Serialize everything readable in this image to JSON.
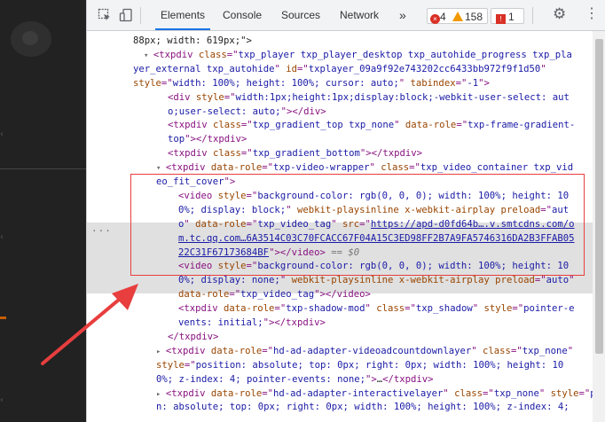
{
  "devtools": {
    "tabs": [
      "Elements",
      "Console",
      "Sources",
      "Network"
    ],
    "active_tab": "Elements",
    "more_tabs_glyph": "»",
    "status": {
      "errors": "4",
      "warnings": "158",
      "issues": "1"
    },
    "icons": {
      "inspect": "inspect-element-icon",
      "device": "device-toolbar-icon",
      "settings": "gear-icon",
      "menu": "kebab-menu-icon"
    },
    "settings_glyph": "⚙",
    "menu_glyph": "⋮"
  },
  "tree": {
    "lines": [
      {
        "parts": [
          [
            "txt",
            "88px; width: 619px;\">"
          ]
        ]
      },
      {
        "parts": [
          [
            "tri",
            "▾ "
          ],
          [
            "tag",
            "<txpdiv "
          ],
          [
            "attr",
            "class"
          ],
          [
            "tag",
            "=\""
          ],
          [
            "val",
            "txp_player txp_player_desktop txp_autohide_progress txp_pla"
          ]
        ]
      },
      {
        "parts": [
          [
            "val",
            "yer_external txp_autohide"
          ],
          [
            "tag",
            "\" "
          ],
          [
            "attr",
            "id"
          ],
          [
            "tag",
            "=\""
          ],
          [
            "val",
            "txplayer_09a9f92e743202cc6433bb972f9f1d50"
          ],
          [
            "tag",
            "\""
          ]
        ]
      },
      {
        "parts": [
          [
            "attr",
            "style"
          ],
          [
            "tag",
            "=\""
          ],
          [
            "val",
            "width: 100%; height: 100%; cursor: auto;"
          ],
          [
            "tag",
            "\" "
          ],
          [
            "attr",
            "tabindex"
          ],
          [
            "tag",
            "=\""
          ],
          [
            "val",
            "-1"
          ],
          [
            "tag",
            "\">"
          ]
        ]
      },
      {
        "parts": [
          [
            "tag",
            "<div "
          ],
          [
            "attr",
            "style"
          ],
          [
            "tag",
            "=\""
          ],
          [
            "val",
            "width:1px;height:1px;display:block;-webkit-user-select: aut"
          ]
        ]
      },
      {
        "parts": [
          [
            "val",
            "o;user-select: auto;"
          ],
          [
            "tag",
            "\"></div>"
          ]
        ]
      },
      {
        "parts": [
          [
            "tag",
            "<txpdiv "
          ],
          [
            "attr",
            "class"
          ],
          [
            "tag",
            "=\""
          ],
          [
            "val",
            "txp_gradient_top txp_none"
          ],
          [
            "tag",
            "\" "
          ],
          [
            "attr",
            "data-role"
          ],
          [
            "tag",
            "=\""
          ],
          [
            "val",
            "txp-frame-gradient-"
          ]
        ]
      },
      {
        "parts": [
          [
            "val",
            "top"
          ],
          [
            "tag",
            "\"></txpdiv>"
          ]
        ]
      },
      {
        "parts": [
          [
            "tag",
            "<txpdiv "
          ],
          [
            "attr",
            "class"
          ],
          [
            "tag",
            "=\""
          ],
          [
            "val",
            "txp_gradient_bottom"
          ],
          [
            "tag",
            "\"></txpdiv>"
          ]
        ]
      },
      {
        "parts": [
          [
            "tri",
            "▾ "
          ],
          [
            "tag",
            "<txpdiv "
          ],
          [
            "attr",
            "data-role"
          ],
          [
            "tag",
            "=\""
          ],
          [
            "val",
            "txp-video-wrapper"
          ],
          [
            "tag",
            "\" "
          ],
          [
            "attr",
            "class"
          ],
          [
            "tag",
            "=\""
          ],
          [
            "val",
            "txp_video_container txp_vid"
          ]
        ]
      },
      {
        "parts": [
          [
            "val",
            "eo_fit_cover"
          ],
          [
            "tag",
            "\">"
          ]
        ]
      },
      {
        "parts": [
          [
            "tag",
            "<video "
          ],
          [
            "attr",
            "style"
          ],
          [
            "tag",
            "=\""
          ],
          [
            "val",
            "background-color: rgb(0, 0, 0); width: 100%; height: 10"
          ]
        ]
      },
      {
        "parts": [
          [
            "val",
            "0%; display: block;"
          ],
          [
            "tag",
            "\" "
          ],
          [
            "attr",
            "webkit-playsinline x-webkit-airplay preload"
          ],
          [
            "tag",
            "=\""
          ],
          [
            "val",
            "aut"
          ]
        ]
      },
      {
        "parts": [
          [
            "val",
            "o"
          ],
          [
            "tag",
            "\" "
          ],
          [
            "attr",
            "data-role"
          ],
          [
            "tag",
            "=\""
          ],
          [
            "val",
            "txp_video_tag"
          ],
          [
            "tag",
            "\" "
          ],
          [
            "attr",
            "src"
          ],
          [
            "tag",
            "=\""
          ],
          [
            "link",
            "https://apd-d0fd64b….v.smtcdns.com/o"
          ]
        ]
      },
      {
        "parts": [
          [
            "link",
            "m.tc.qq.com…6A3514C03C70FCACC67F04A15C3ED98FF2B7A9FA5746316DA2B3FFAB05"
          ]
        ]
      },
      {
        "parts": [
          [
            "link",
            "22C31F67173684BF"
          ],
          [
            "tag",
            "\"></video>"
          ],
          [
            "eq0",
            " == $0"
          ]
        ]
      },
      {
        "parts": [
          [
            "tag",
            "<video "
          ],
          [
            "attr",
            "style"
          ],
          [
            "tag",
            "=\""
          ],
          [
            "val",
            "background-color: rgb(0, 0, 0); width: 100%; height: 10"
          ]
        ]
      },
      {
        "parts": [
          [
            "val",
            "0%; display: none;"
          ],
          [
            "tag",
            "\" "
          ],
          [
            "attr",
            "webkit-playsinline x-webkit-airplay preload"
          ],
          [
            "tag",
            "=\""
          ],
          [
            "val",
            "auto"
          ],
          [
            "tag",
            "\""
          ]
        ]
      },
      {
        "parts": [
          [
            "attr",
            "data-role"
          ],
          [
            "tag",
            "=\""
          ],
          [
            "val",
            "txp_video_tag"
          ],
          [
            "tag",
            "\"></video>"
          ]
        ]
      },
      {
        "parts": [
          [
            "tag",
            "<txpdiv "
          ],
          [
            "attr",
            "data-role"
          ],
          [
            "tag",
            "=\""
          ],
          [
            "val",
            "txp-shadow-mod"
          ],
          [
            "tag",
            "\" "
          ],
          [
            "attr",
            "class"
          ],
          [
            "tag",
            "=\""
          ],
          [
            "val",
            "txp_shadow"
          ],
          [
            "tag",
            "\" "
          ],
          [
            "attr",
            "style"
          ],
          [
            "tag",
            "=\""
          ],
          [
            "val",
            "pointer-e"
          ]
        ]
      },
      {
        "parts": [
          [
            "val",
            "vents: initial;"
          ],
          [
            "tag",
            "\"></txpdiv>"
          ]
        ]
      },
      {
        "parts": [
          [
            "tag",
            "</txpdiv>"
          ]
        ]
      },
      {
        "parts": [
          [
            "tri",
            "▸ "
          ],
          [
            "tag",
            "<txpdiv "
          ],
          [
            "attr",
            "data-role"
          ],
          [
            "tag",
            "=\""
          ],
          [
            "val",
            "hd-ad-adapter-videoadcountdownlayer"
          ],
          [
            "tag",
            "\" "
          ],
          [
            "attr",
            "class"
          ],
          [
            "tag",
            "=\""
          ],
          [
            "val",
            "txp_none"
          ],
          [
            "tag",
            "\""
          ]
        ]
      },
      {
        "parts": [
          [
            "attr",
            "style"
          ],
          [
            "tag",
            "=\""
          ],
          [
            "val",
            "position: absolute; top: 0px; right: 0px; width: 100%; height: 10"
          ]
        ]
      },
      {
        "parts": [
          [
            "val",
            "0%; z-index: 4; pointer-events: none;"
          ],
          [
            "tag",
            "\">"
          ],
          [
            "txt",
            "…"
          ],
          [
            "tag",
            "</txpdiv>"
          ]
        ]
      },
      {
        "parts": [
          [
            "tri",
            "▸ "
          ],
          [
            "tag",
            "<txpdiv "
          ],
          [
            "attr",
            "data-role"
          ],
          [
            "tag",
            "=\""
          ],
          [
            "val",
            "hd-ad-adapter-interactivelayer"
          ],
          [
            "tag",
            "\" "
          ],
          [
            "attr",
            "class"
          ],
          [
            "tag",
            "=\""
          ],
          [
            "val",
            "txp_none"
          ],
          [
            "tag",
            "\" "
          ],
          [
            "attr",
            "style"
          ],
          [
            "tag",
            "=\""
          ],
          [
            "val",
            "positio"
          ]
        ]
      },
      {
        "parts": [
          [
            "val",
            "n: absolute; top: 0px; right: 0px; width: 100%; height: 100%; z-index: 4;"
          ]
        ]
      }
    ]
  },
  "colors": {
    "tag": "#881280",
    "attr": "#994500",
    "value": "#1a1aa6",
    "annotation": "#e83e3e",
    "active_tab_underline": "#1a73e8"
  }
}
